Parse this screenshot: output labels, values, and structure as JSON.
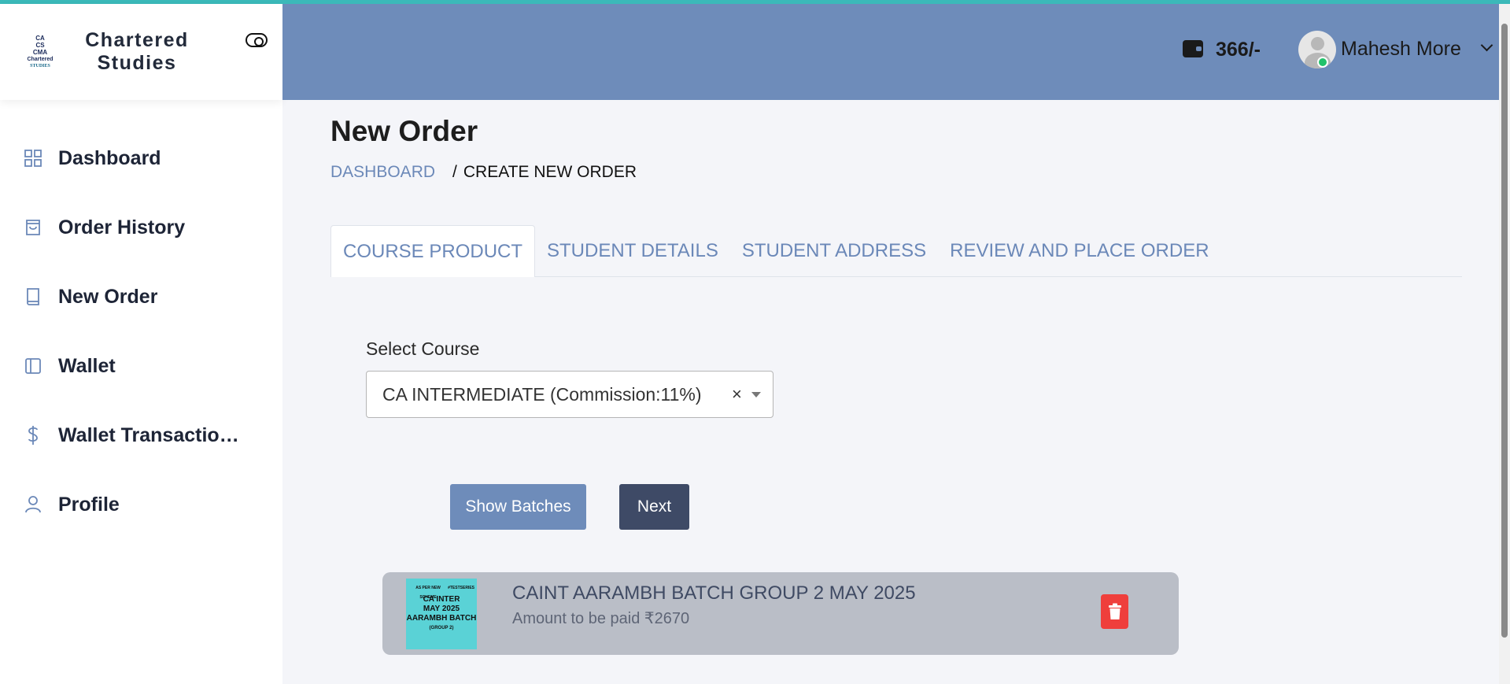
{
  "brand": {
    "logo_lines": [
      "CA",
      "CS",
      "CMA",
      "Chartered",
      "STUDIES"
    ],
    "name_line1": "Chartered",
    "name_line2": "Studies"
  },
  "sidebar": {
    "items": [
      {
        "label": "Dashboard",
        "icon": "grid-icon"
      },
      {
        "label": "Order History",
        "icon": "shopping-bag-icon"
      },
      {
        "label": "New Order",
        "icon": "book-icon"
      },
      {
        "label": "Wallet",
        "icon": "sidebar-panel-icon"
      },
      {
        "label": "Wallet Transactions",
        "icon": "dollar-icon"
      },
      {
        "label": "Profile",
        "icon": "user-icon"
      }
    ]
  },
  "header": {
    "wallet_amount": "366/-",
    "user_name": "Mahesh More"
  },
  "page": {
    "title": "New Order",
    "breadcrumb": {
      "home": "DASHBOARD",
      "separator": "/",
      "current": "CREATE NEW ORDER"
    }
  },
  "tabs": [
    {
      "label": "COURSE PRODUCT",
      "active": true
    },
    {
      "label": "STUDENT DETAILS",
      "active": false
    },
    {
      "label": "STUDENT ADDRESS",
      "active": false
    },
    {
      "label": "REVIEW AND PLACE ORDER",
      "active": false
    }
  ],
  "form": {
    "select_label": "Select Course",
    "select_value": "CA INTERMEDIATE (Commission:11%)",
    "clear_symbol": "×"
  },
  "buttons": {
    "show_batches": "Show Batches",
    "next": "Next"
  },
  "batch": {
    "thumb": {
      "header_left": "AS PER NEW SCHEME",
      "header_right": "#TESTSERIES",
      "line1": "CA INTER",
      "line2": "MAY 2025",
      "line3": "AARAMBH BATCH",
      "line4": "(GROUP 2)"
    },
    "title": "CAINT AARAMBH BATCH GROUP 2 MAY 2025",
    "amount_label": "Amount to be paid ₹2670"
  },
  "colors": {
    "accent": "#6e8cba",
    "dark_button": "#3e4a66",
    "delete": "#ef3f3c",
    "online": "#21c26b"
  }
}
